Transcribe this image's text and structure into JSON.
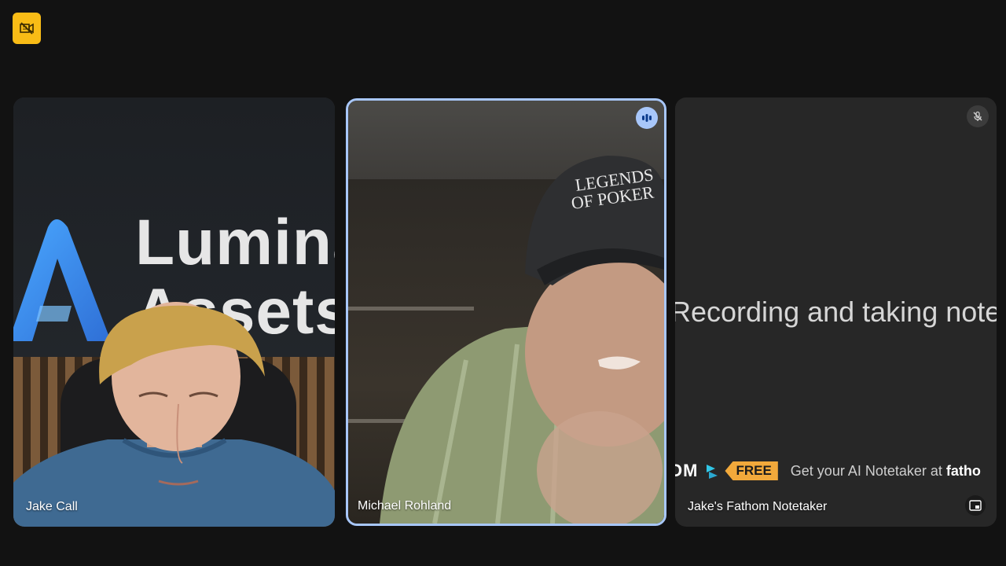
{
  "badge": {
    "icon": "video-off-icon",
    "color": "#f9bc16"
  },
  "tiles": [
    {
      "name": "Jake Call",
      "banner_line_1": "Lumina",
      "banner_line_2": "Assets"
    },
    {
      "name": "Michael Rohland",
      "cap_line_1": "LEGENDS",
      "cap_line_2": "OF POKER",
      "speaking": true,
      "highlight_color": "#a8c7fa"
    },
    {
      "name": "Jake's Fathom Notetaker",
      "recording_text": "Recording and taking notes",
      "promo_brand": "OM",
      "promo_free": "FREE",
      "promo_cta": "Get your AI Notetaker at",
      "promo_cta_bold": "fatho",
      "muted": true
    }
  ],
  "colors": {
    "background": "#121212",
    "free_tag": "#f2a93b",
    "fathom_logo": "#31c6e6"
  }
}
